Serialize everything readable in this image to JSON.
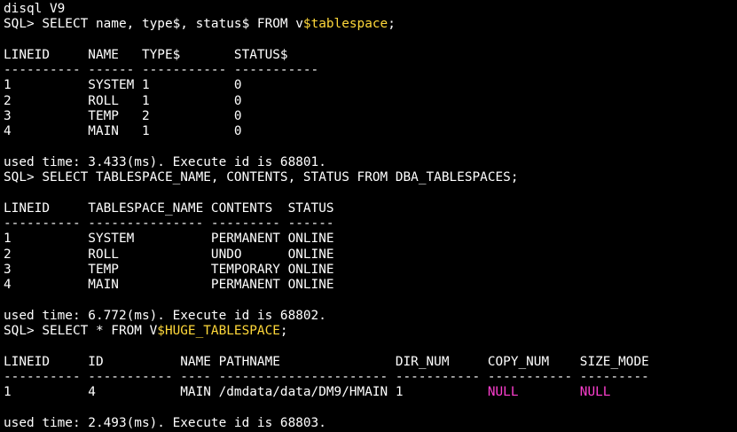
{
  "window": {
    "title": "disql V9"
  },
  "colors": {
    "background": "#000000",
    "text": "#ffffff",
    "highlight": "#ffd83a",
    "null_value": "#ff3fd0"
  },
  "lines": [
    [
      {
        "t": "disql V9"
      }
    ],
    [
      {
        "t": "SQL> SELECT name, type$, status$ FROM v"
      },
      {
        "t": "$tablespace",
        "c": "hl-yellow"
      },
      {
        "t": ";"
      }
    ],
    [
      {
        "t": ""
      }
    ],
    [
      {
        "t": "LINEID     NAME   TYPE$       STATUS$"
      }
    ],
    [
      {
        "t": "---------- ------ ----------- -----------"
      }
    ],
    [
      {
        "t": "1          SYSTEM 1           0"
      }
    ],
    [
      {
        "t": "2          ROLL   1           0"
      }
    ],
    [
      {
        "t": "3          TEMP   2           0"
      }
    ],
    [
      {
        "t": "4          MAIN   1           0"
      }
    ],
    [
      {
        "t": ""
      }
    ],
    [
      {
        "t": "used time: 3.433(ms). Execute id is 68801."
      }
    ],
    [
      {
        "t": "SQL> SELECT TABLESPACE_NAME, CONTENTS, STATUS FROM DBA_TABLESPACES;"
      }
    ],
    [
      {
        "t": ""
      }
    ],
    [
      {
        "t": "LINEID     TABLESPACE_NAME CONTENTS  STATUS"
      }
    ],
    [
      {
        "t": "---------- --------------- --------- ------"
      }
    ],
    [
      {
        "t": "1          SYSTEM          PERMANENT ONLINE"
      }
    ],
    [
      {
        "t": "2          ROLL            UNDO      ONLINE"
      }
    ],
    [
      {
        "t": "3          TEMP            TEMPORARY ONLINE"
      }
    ],
    [
      {
        "t": "4          MAIN            PERMANENT ONLINE"
      }
    ],
    [
      {
        "t": ""
      }
    ],
    [
      {
        "t": "used time: 6.772(ms). Execute id is 68802."
      }
    ],
    [
      {
        "t": "SQL> SELECT * FROM V"
      },
      {
        "t": "$HUGE_TABLESPACE",
        "c": "hl-yellow"
      },
      {
        "t": ";"
      }
    ],
    [
      {
        "t": ""
      }
    ],
    [
      {
        "t": "LINEID     ID          NAME PATHNAME               DIR_NUM     COPY_NUM    SIZE_MODE"
      }
    ],
    [
      {
        "t": "---------- ----------- ---- ---------------------- ----------- ----------- ---------"
      }
    ],
    [
      {
        "t": "1          4           MAIN /dmdata/data/DM9/HMAIN 1           "
      },
      {
        "t": "NULL",
        "c": "hl-magenta"
      },
      {
        "t": "        "
      },
      {
        "t": "NULL",
        "c": "hl-magenta"
      }
    ],
    [
      {
        "t": ""
      }
    ],
    [
      {
        "t": "used time: 2.493(ms). Execute id is 68803."
      }
    ]
  ]
}
